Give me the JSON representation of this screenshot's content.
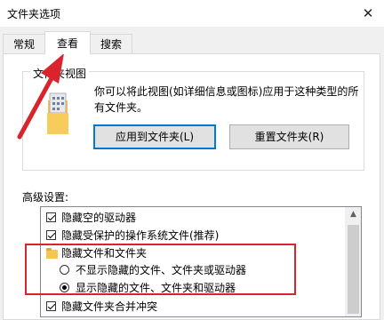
{
  "window": {
    "title": "文件夹选项",
    "close_symbol": "✕"
  },
  "tabs": [
    {
      "label": "常规",
      "active": false
    },
    {
      "label": "查看",
      "active": true
    },
    {
      "label": "搜索",
      "active": false
    }
  ],
  "folder_views": {
    "group_label": "文件夹视图",
    "description": "你可以将此视图(如详细信息或图标)应用于这种类型的所有文件夹。",
    "apply_button": "应用到文件夹(L)",
    "reset_button": "重置文件夹(R)"
  },
  "advanced": {
    "label": "高级设置:",
    "items": [
      {
        "label": "隐藏空的驱动器",
        "type": "checkbox",
        "checked": true
      },
      {
        "label": "隐藏受保护的操作系统文件(推荐)",
        "type": "checkbox",
        "checked": true
      },
      {
        "label": "隐藏文件和文件夹",
        "type": "folder"
      },
      {
        "label": "不显示隐藏的文件、文件夹或驱动器",
        "type": "radio",
        "checked": false
      },
      {
        "label": "显示隐藏的文件、文件夹和驱动器",
        "type": "radio",
        "checked": true
      },
      {
        "label": "隐藏文件夹合并冲突",
        "type": "checkbox",
        "checked": true
      }
    ]
  },
  "colors": {
    "annotation": "#d9232d",
    "accent": "#0078d7"
  }
}
